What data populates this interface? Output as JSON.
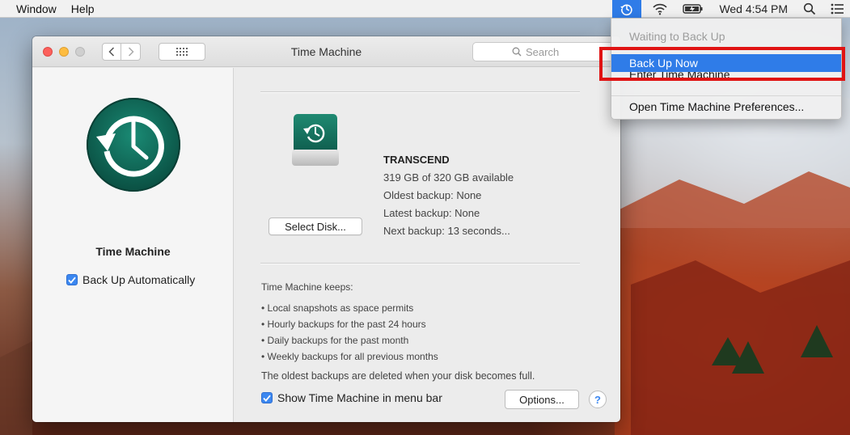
{
  "menubar": {
    "items": [
      "Window",
      "Help"
    ],
    "clock": "Wed 4:54 PM"
  },
  "window": {
    "title": "Time Machine",
    "search_placeholder": "Search"
  },
  "sidebar": {
    "app_name": "Time Machine",
    "auto_backup_label": "Back Up Automatically",
    "auto_backup_checked": true
  },
  "disk": {
    "name": "TRANSCEND",
    "available": "319 GB of 320 GB available",
    "oldest": "Oldest backup: None",
    "latest": "Latest backup: None",
    "next": "Next backup: 13 seconds...",
    "select_label": "Select Disk..."
  },
  "keeps": {
    "heading": "Time Machine keeps:",
    "items": [
      "• Local snapshots as space permits",
      "• Hourly backups for the past 24 hours",
      "• Daily backups for the past month",
      "• Weekly backups for all previous months"
    ],
    "note": "The oldest backups are deleted when your disk becomes full."
  },
  "footer": {
    "show_in_menubar_label": "Show Time Machine in menu bar",
    "show_in_menubar_checked": true,
    "options_label": "Options...",
    "help_label": "?"
  },
  "dropdown": {
    "status": "Waiting to Back Up",
    "back_up_now": "Back Up Now",
    "enter_tm": "Enter Time Machine",
    "open_prefs": "Open Time Machine Preferences..."
  },
  "colors": {
    "accent": "#2f7ce8",
    "highlight": "#e01313",
    "tm_green": "#0f6b5a"
  },
  "icons": [
    "time-machine-icon",
    "wifi-icon",
    "battery-icon",
    "spotlight-icon",
    "notification-center-icon"
  ]
}
